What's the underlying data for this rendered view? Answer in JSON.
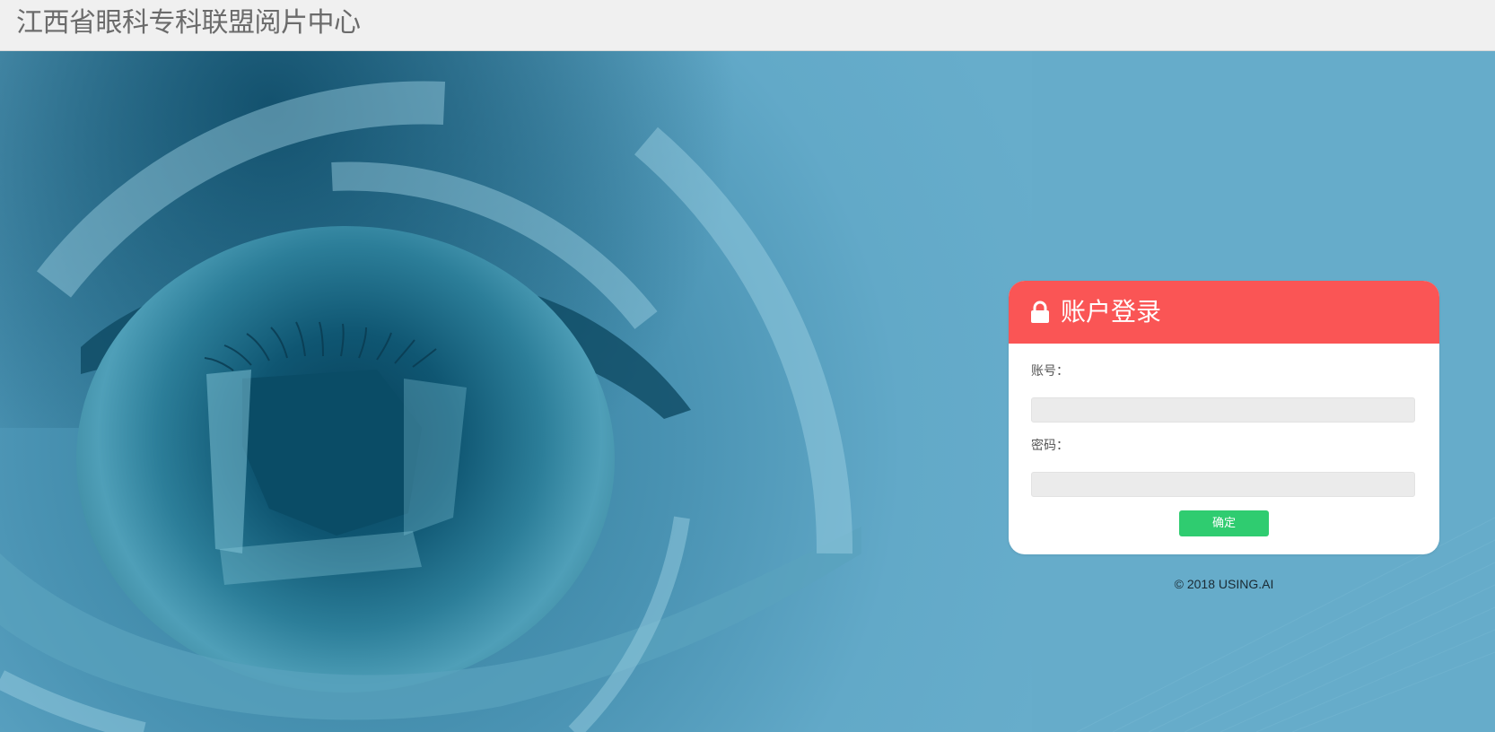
{
  "header": {
    "title": "江西省眼科专科联盟阅片中心"
  },
  "hero": {
    "image_icon": "eye-image",
    "background_color": "#66acca"
  },
  "login": {
    "lock_icon": "lock-icon",
    "title": "账户登录",
    "header_color": "#fa5555",
    "account_label": "账号：",
    "account_value": "",
    "password_label": "密码：",
    "password_value": "",
    "submit_label": "确定",
    "submit_color": "#2fcc70"
  },
  "footer": {
    "copyright": "© 2018 USING.AI"
  }
}
